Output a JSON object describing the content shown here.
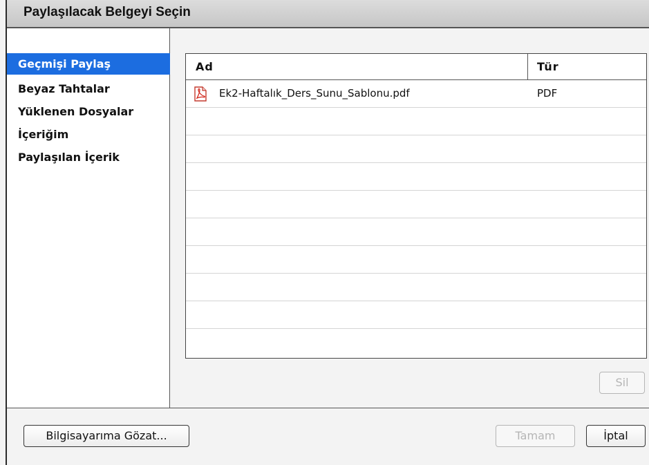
{
  "dialog": {
    "title": "Paylaşılacak Belgeyi Seçin"
  },
  "sidebar": {
    "items": [
      {
        "label": "Geçmişi Paylaş",
        "selected": true
      },
      {
        "label": "Beyaz Tahtalar",
        "selected": false
      },
      {
        "label": "Yüklenen Dosyalar",
        "selected": false
      },
      {
        "label": "İçeriğim",
        "selected": false
      },
      {
        "label": "Paylaşılan İçerik",
        "selected": false
      }
    ]
  },
  "table": {
    "columns": {
      "name": "Ad",
      "type": "Tür"
    },
    "rows": [
      {
        "name": "Ek2-Haftalık_Ders_Sunu_Sablonu.pdf",
        "type": "PDF",
        "icon": "pdf-file-icon"
      }
    ]
  },
  "buttons": {
    "delete": "Sil",
    "browse": "Bilgisayarıma Gözat...",
    "ok": "Tamam",
    "cancel": "İptal"
  },
  "colors": {
    "selection": "#1c6de0",
    "pdf_icon": "#d42a1e"
  }
}
